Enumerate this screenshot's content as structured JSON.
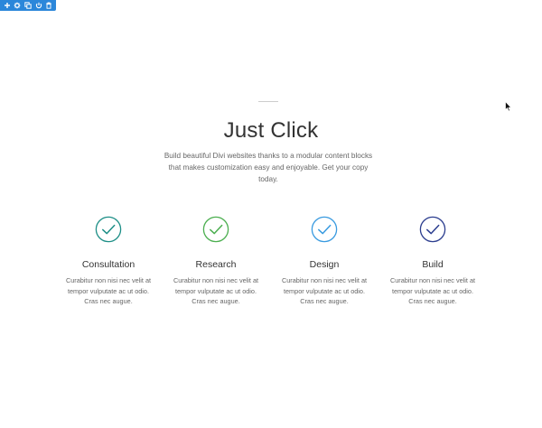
{
  "toolbar": {
    "buttons": [
      {
        "icon": "plus-icon",
        "label": "Add"
      },
      {
        "icon": "gear-icon",
        "label": "Settings"
      },
      {
        "icon": "duplicate-icon",
        "label": "Duplicate"
      },
      {
        "icon": "power-icon",
        "label": "Toggle"
      },
      {
        "icon": "trash-icon",
        "label": "Delete"
      }
    ],
    "color": "#2b87da"
  },
  "header": {
    "title": "Just Click",
    "subtitle": "Build beautiful Divi websites thanks to a modular content blocks that makes customization easy and enjoyable. Get your copy today."
  },
  "features": [
    {
      "title": "Consultation",
      "body": "Curabitur non nisi nec velit at tempor vulputate ac ut odio. Cras nec augue.",
      "color": "#1e8f87",
      "icon": "check-circle-icon"
    },
    {
      "title": "Research",
      "body": "Curabitur non nisi nec velit at tempor vulputate ac ut odio. Cras nec augue.",
      "color": "#4caf50",
      "icon": "check-circle-icon"
    },
    {
      "title": "Design",
      "body": "Curabitur non nisi nec velit at tempor vulputate ac ut odio. Cras nec augue.",
      "color": "#3a9be0",
      "icon": "check-circle-icon"
    },
    {
      "title": "Build",
      "body": "Curabitur non nisi nec velit at tempor vulputate ac ut odio. Cras nec augue.",
      "color": "#2c3e8f",
      "icon": "check-circle-icon"
    }
  ]
}
